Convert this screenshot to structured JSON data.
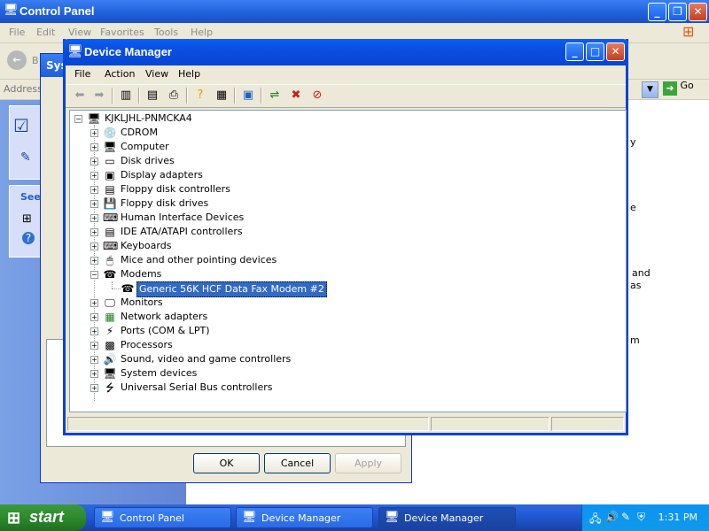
{
  "control_panel": {
    "title": "Control Panel",
    "menu": [
      "File",
      "Edit",
      "View",
      "Favorites",
      "Tools",
      "Help"
    ],
    "address_label": "Address",
    "go_label": "Go",
    "see_label": "See",
    "right_text_1": "and",
    "right_text_2": "as",
    "right_text_3": "m",
    "right_text_4": "e",
    "right_text_5": "y"
  },
  "system_dialog": {
    "title": "Sys",
    "ok_label": "OK",
    "cancel_label": "Cancel",
    "apply_label": "Apply"
  },
  "device_manager": {
    "title": "Device Manager",
    "menu": [
      "File",
      "Action",
      "View",
      "Help"
    ],
    "root": "KJKLJHL-PNMCKA4",
    "categories": [
      "CDROM",
      "Computer",
      "Disk drives",
      "Display adapters",
      "Floppy disk controllers",
      "Floppy disk drives",
      "Human Interface Devices",
      "IDE ATA/ATAPI controllers",
      "Keyboards",
      "Mice and other pointing devices",
      "Modems",
      "Monitors",
      "Network adapters",
      "Ports (COM & LPT)",
      "Processors",
      "Sound, video and game controllers",
      "System devices",
      "Universal Serial Bus controllers"
    ],
    "modem_child": "Generic 56K HCF Data Fax Modem #2"
  },
  "taskbar": {
    "start_label": "start",
    "tasks": [
      "Control Panel",
      "Device Manager",
      "Device Manager"
    ],
    "clock": "1:31 PM"
  }
}
